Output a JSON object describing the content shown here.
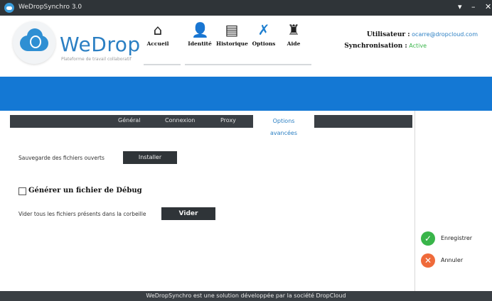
{
  "window": {
    "title": "WeDropSynchro 3.0",
    "controls": [
      "▾",
      "–",
      "✕"
    ]
  },
  "brand": {
    "name": "WeDrop",
    "tagline": "Plateforme de travail collaboratif"
  },
  "nav": [
    {
      "label": "Accueil",
      "icon": "home-icon"
    },
    {
      "label": "Identité",
      "icon": "user-icon"
    },
    {
      "label": "Historique",
      "icon": "document-icon"
    },
    {
      "label": "Options",
      "icon": "tools-icon"
    },
    {
      "label": "Aide",
      "icon": "alarm-icon"
    }
  ],
  "user": {
    "utilisateur_label": "Utilisateur :",
    "utilisateur_value": "ocarre@dropcloud.com",
    "sync_label": "Synchronisation :",
    "sync_value": "Active"
  },
  "tabs": [
    "Général",
    "Connexion",
    "Proxy",
    "Options avancées"
  ],
  "active_tab": "Options avancées",
  "options": {
    "backup_label": "Sauvegarde des fichiers ouverts",
    "backup_button": "Installer",
    "debug_label": "Générer un fichier de Débug",
    "debug_checked": false,
    "trash_label": "Vider tous les fichiers présents dans la corbeille",
    "trash_button": "Vider"
  },
  "actions": {
    "save": "Enregistrer",
    "cancel": "Annuler"
  },
  "footer": "WeDropSynchro est une solution développée par la société DropCloud",
  "colors": {
    "accent": "#1478d4",
    "dark": "#2f3438",
    "success": "#39b54a",
    "danger": "#ef6a3a"
  }
}
